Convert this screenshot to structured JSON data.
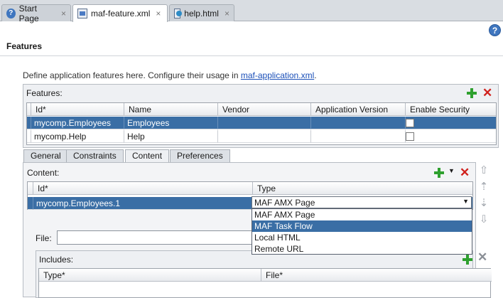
{
  "tabs": [
    {
      "label": "Start Page",
      "icon": "help-icon"
    },
    {
      "label": "maf-feature.xml",
      "icon": "xml-file-icon"
    },
    {
      "label": "help.html",
      "icon": "html-file-icon"
    }
  ],
  "tab_close_glyph": "×",
  "help_glyph": "?",
  "page": {
    "title": "Features",
    "description_prefix": "Define application features here. Configure their usage in ",
    "description_link": "maf-application.xml",
    "description_suffix": "."
  },
  "features_panel": {
    "label": "Features:",
    "columns": [
      "Id*",
      "Name",
      "Vendor",
      "Application Version",
      "Enable Security"
    ],
    "rows": [
      {
        "id": "mycomp.Employees",
        "name": "Employees",
        "vendor": "",
        "app_version": "",
        "enable_security": false,
        "selected": true
      },
      {
        "id": "mycomp.Help",
        "name": "Help",
        "vendor": "",
        "app_version": "",
        "enable_security": false,
        "selected": false
      }
    ]
  },
  "subtabs": [
    "General",
    "Constraints",
    "Content",
    "Preferences"
  ],
  "active_subtab": "Content",
  "content_panel": {
    "label": "Content:",
    "columns": [
      "Id*",
      "Type"
    ],
    "rows": [
      {
        "id": "mycomp.Employees.1",
        "type": "MAF AMX Page",
        "selected": true
      }
    ]
  },
  "type_dropdown": {
    "value": "MAF AMX Page",
    "options": [
      "MAF AMX Page",
      "MAF Task Flow",
      "Local HTML",
      "Remote URL"
    ],
    "highlighted": "MAF Task Flow"
  },
  "file_field": {
    "label": "File:",
    "value": ""
  },
  "includes_panel": {
    "label": "Includes:",
    "columns": [
      "Type*",
      "File*"
    ]
  },
  "colors": {
    "selection": "#3a6ea5",
    "add": "#2ea02e",
    "delete": "#d0201c",
    "link": "#1a4fb8"
  }
}
